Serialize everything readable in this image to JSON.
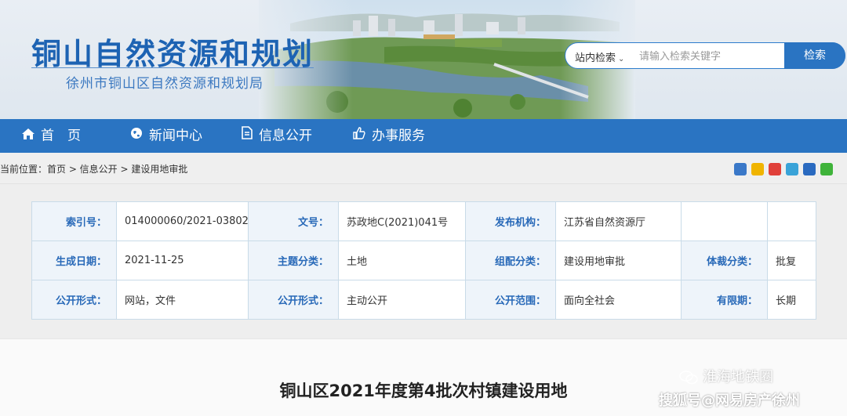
{
  "header": {
    "title": "铜山自然资源和规划",
    "subtitle": "徐州市铜山区自然资源和规划局"
  },
  "search": {
    "scope": "站内检索",
    "placeholder": "请输入检索关键字",
    "button": "检索"
  },
  "nav": {
    "items": [
      {
        "label": "首　页",
        "icon": "home-icon"
      },
      {
        "label": "新闻中心",
        "icon": "globe-icon"
      },
      {
        "label": "信息公开",
        "icon": "document-icon"
      },
      {
        "label": "办事服务",
        "icon": "thumbs-up-icon"
      }
    ]
  },
  "breadcrumb": {
    "text": "当前位置：首页 > 信息公开 > 建设用地审批"
  },
  "share_icons": [
    "plus-share-icon",
    "qzone-icon",
    "weibo-icon",
    "tencent-weibo-icon",
    "renren-icon",
    "wechat-icon"
  ],
  "info": {
    "rows": [
      [
        {
          "label": "索引号：",
          "value": "014000060/2021-03802"
        },
        {
          "label": "文号：",
          "value": "苏政地C(2021)041号"
        },
        {
          "label": "发布机构：",
          "value": "江苏省自然资源厅"
        },
        {
          "label": "",
          "value": ""
        }
      ],
      [
        {
          "label": "生成日期：",
          "value": "2021-11-25"
        },
        {
          "label": "主题分类：",
          "value": "土地"
        },
        {
          "label": "组配分类：",
          "value": "建设用地审批"
        },
        {
          "label": "体裁分类：",
          "value": "批复"
        }
      ],
      [
        {
          "label": "公开形式：",
          "value": "网站，文件"
        },
        {
          "label": "公开形式：",
          "value": "主动公开"
        },
        {
          "label": "公开范围：",
          "value": "面向全社会"
        },
        {
          "label": "有限期：",
          "value": "长期"
        }
      ]
    ]
  },
  "article": {
    "title": "铜山区2021年度第4批次村镇建设用地"
  },
  "watermarks": {
    "line1": "淮海地铁圈",
    "line2": "搜狐号@网易房产徐州"
  },
  "colors": {
    "brand_blue": "#2a74c2",
    "title_blue": "#1d63b3",
    "label_blue": "#2869b8"
  }
}
